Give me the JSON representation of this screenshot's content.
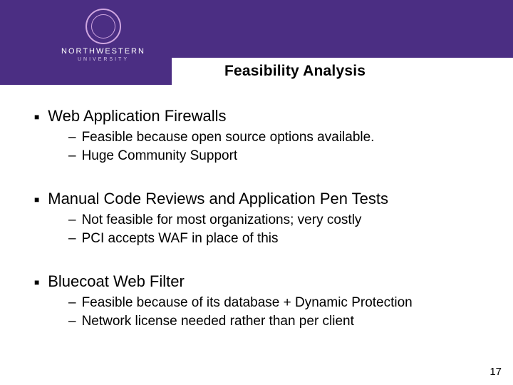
{
  "header": {
    "brand_wordmark": "NORTHWESTERN",
    "brand_sub": "UNIVERSITY",
    "title": "Feasibility Analysis"
  },
  "bullets": [
    {
      "text": "Web Application Firewalls",
      "sub": [
        "Feasible because open source options available.",
        "Huge Community Support"
      ]
    },
    {
      "text": "Manual Code Reviews and Application Pen Tests",
      "sub": [
        "Not feasible for most organizations; very costly",
        "PCI accepts WAF in place of this"
      ]
    },
    {
      "text": "Bluecoat Web Filter",
      "sub": [
        "Feasible because of its database + Dynamic Protection",
        "Network license needed rather than per client"
      ]
    }
  ],
  "page_number": "17"
}
